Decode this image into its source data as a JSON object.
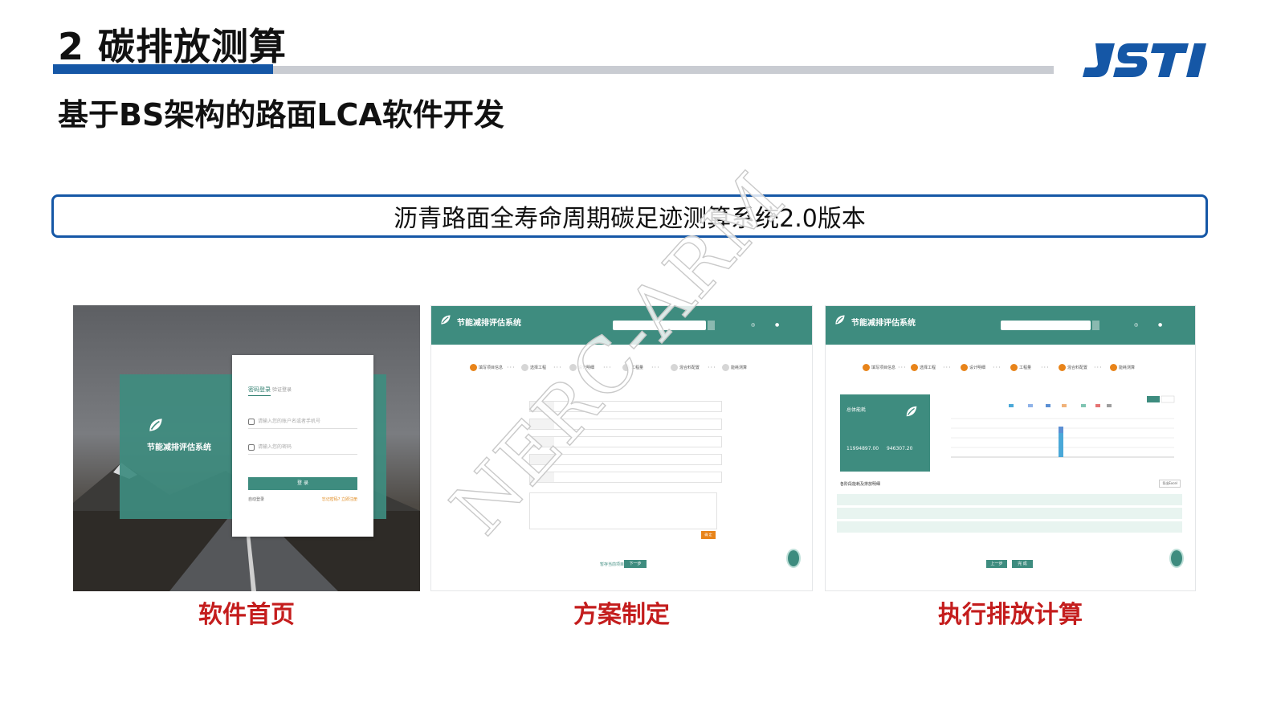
{
  "header": {
    "title": "2 碳排放测算",
    "logo_text": "JSTI",
    "accent_color": "#1557a6",
    "divider_color": "#c9ccd2"
  },
  "subtitle": "基于BS架构的路面LCA软件开发",
  "system_name": "沥青路面全寿命周期碳足迹测算系统2.0版本",
  "screenshots": [
    {
      "caption": "软件首页",
      "app_name": "节能减排评估系统",
      "login": {
        "tab_active": "密码登录",
        "tab_other": "验证登录",
        "username_placeholder": "请输入您的账户名或者手机号",
        "password_placeholder": "请输入您的密码",
        "login_button": "登 录",
        "remember": "自动登录",
        "forgot": "忘记密码? 立即注册"
      }
    },
    {
      "caption": "方案制定",
      "app_name": "节能减排评估系统",
      "steps": [
        "填写项目信息",
        "选择工程",
        "设计明细",
        "工程量",
        "混合料配置",
        "能耗测算"
      ],
      "next_button": "下一步",
      "save_link": "暂存当前项目",
      "ok_button": "确 定"
    },
    {
      "caption": "执行排放计算",
      "app_name": "节能减排评估系统",
      "steps": [
        "填写项目信息",
        "选择工程",
        "设计明细",
        "工程量",
        "混合料配置",
        "能耗测算"
      ],
      "summary": {
        "title": "总体能耗",
        "value1": "11994897.00",
        "value2": "946307.20"
      },
      "table_title": "各阶段能耗及排放明细",
      "export_button": "导出Excel",
      "prev_button": "上一步",
      "finish_button": "完 成"
    }
  ],
  "colors": {
    "app_green": "#3e8c7f",
    "step_active": "#e8841a",
    "caption_red": "#c41d1d"
  },
  "watermark": "NERC-ARM"
}
